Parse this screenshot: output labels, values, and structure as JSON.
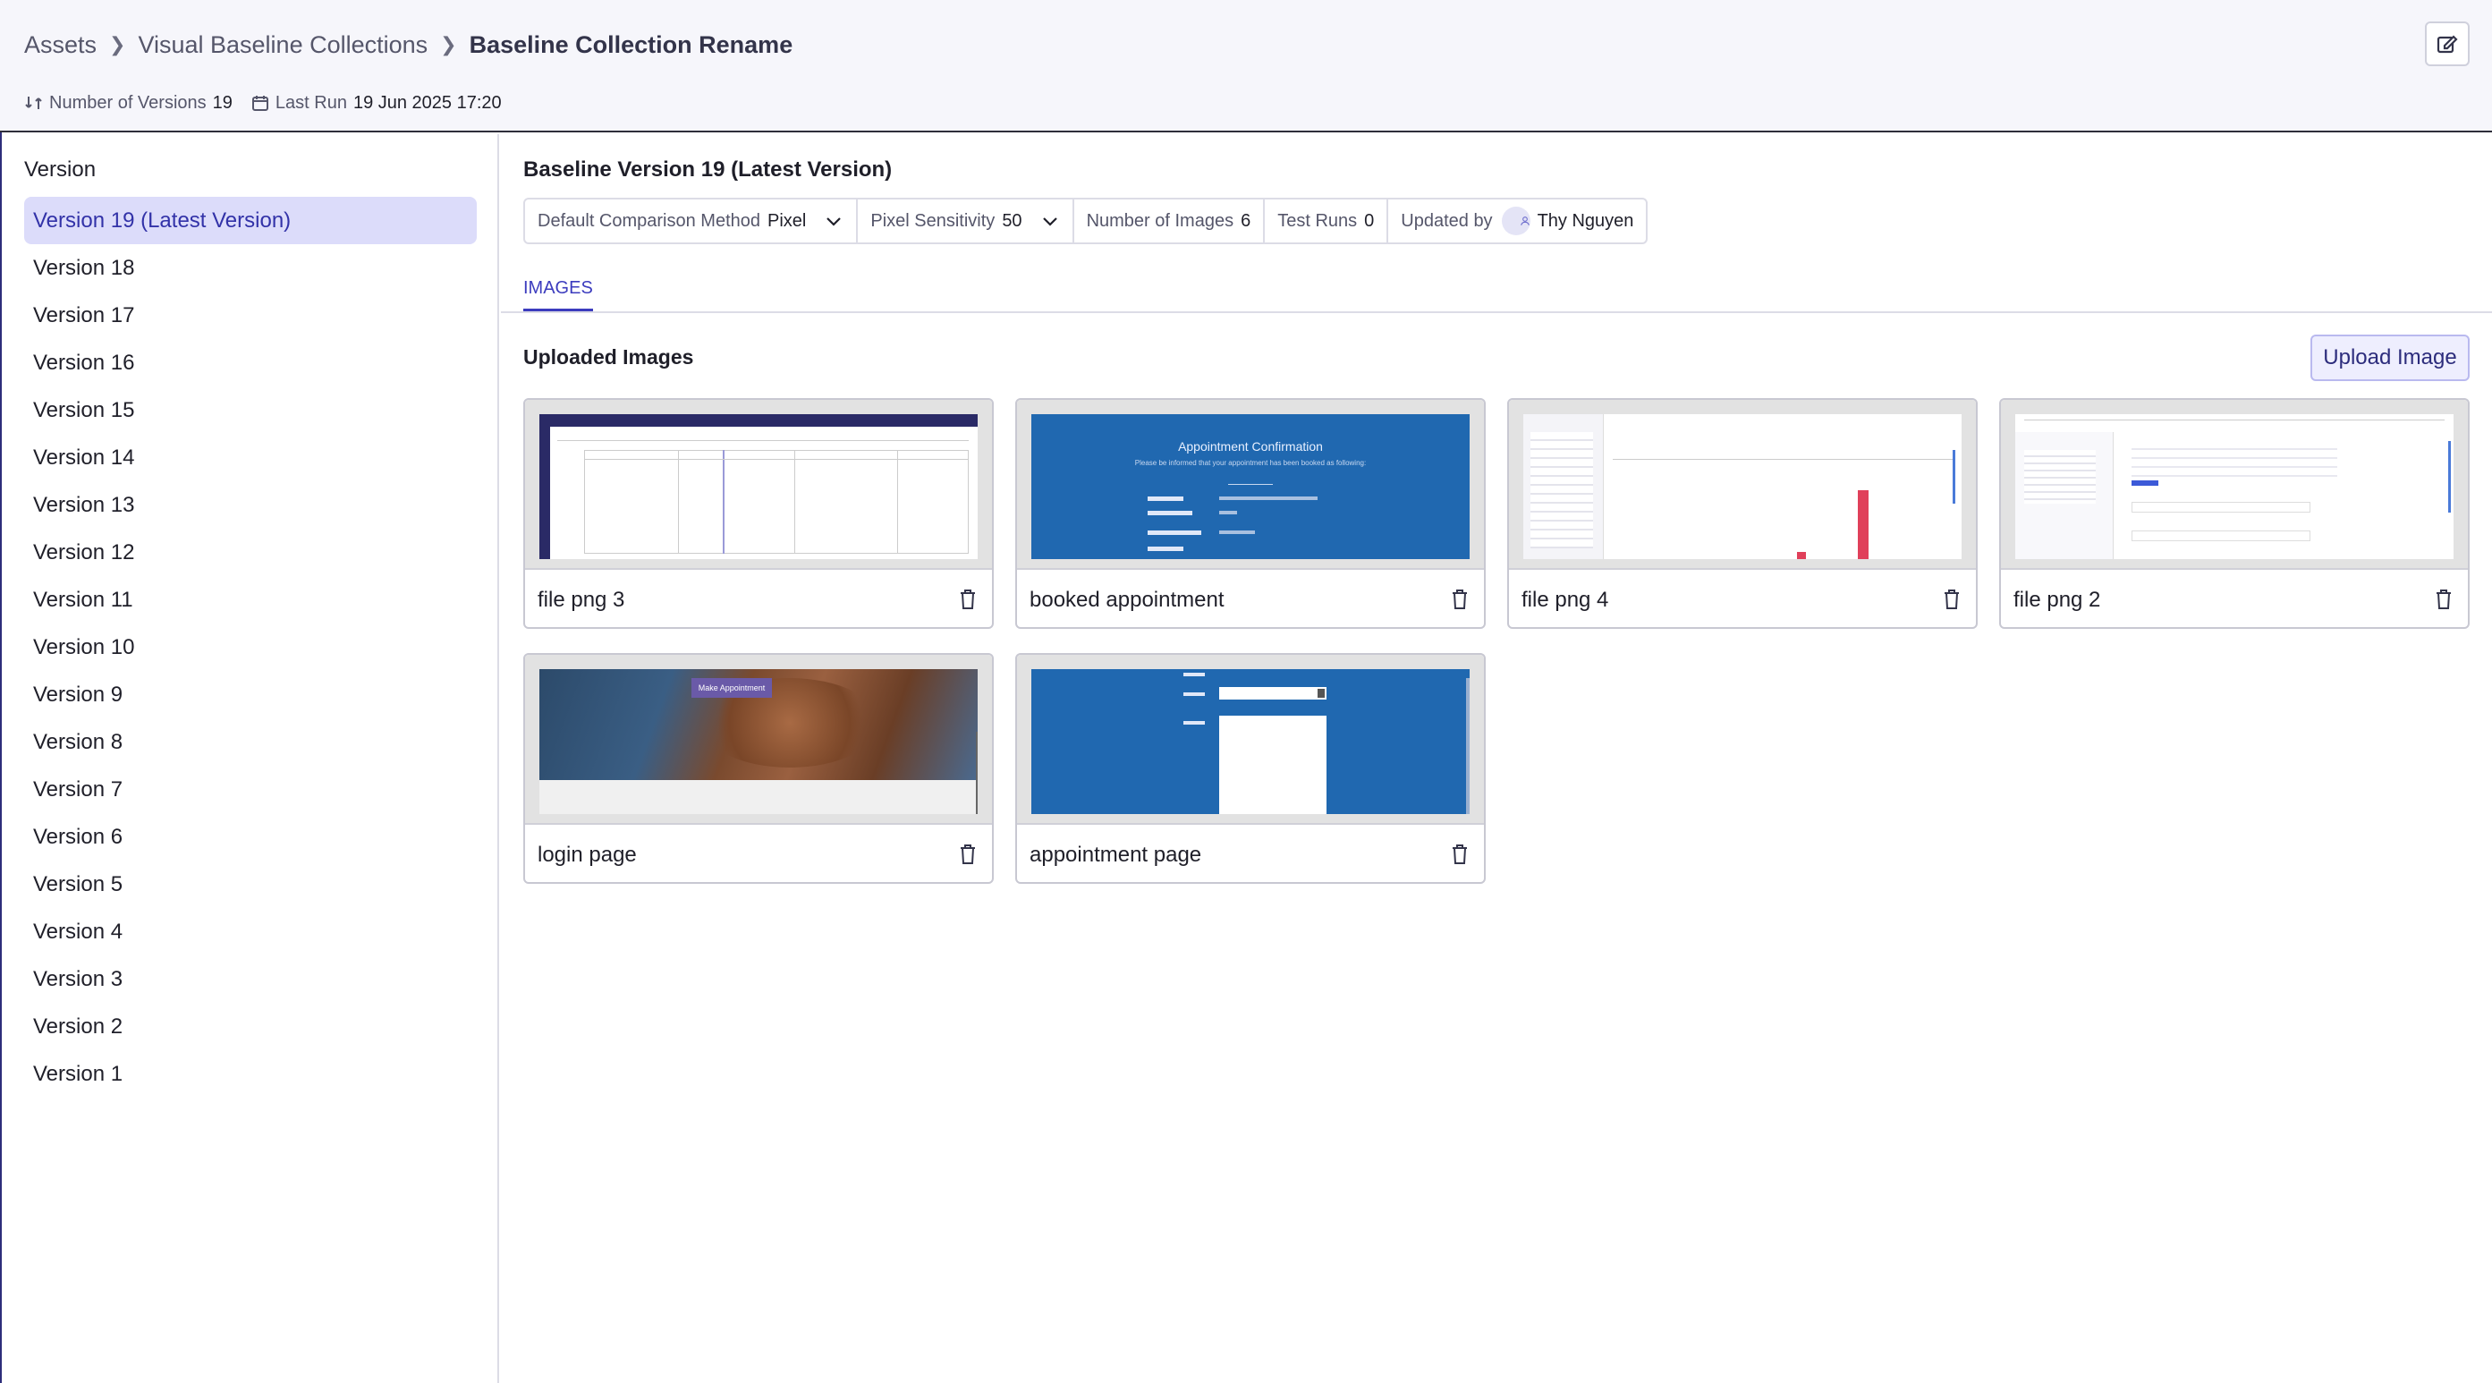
{
  "header": {
    "breadcrumb": [
      "Assets",
      "Visual Baseline Collections",
      "Baseline Collection Rename"
    ],
    "versions_label": "Number of Versions",
    "versions_value": "19",
    "last_run_label": "Last Run",
    "last_run_value": "19 Jun 2025 17:20"
  },
  "sidebar": {
    "title": "Version",
    "items": [
      {
        "label": "Version 19 (Latest Version)",
        "active": true
      },
      {
        "label": "Version 18"
      },
      {
        "label": "Version 17"
      },
      {
        "label": "Version 16"
      },
      {
        "label": "Version 15"
      },
      {
        "label": "Version 14"
      },
      {
        "label": "Version 13"
      },
      {
        "label": "Version 12"
      },
      {
        "label": "Version 11"
      },
      {
        "label": "Version 10"
      },
      {
        "label": "Version 9"
      },
      {
        "label": "Version 8"
      },
      {
        "label": "Version 7"
      },
      {
        "label": "Version 6"
      },
      {
        "label": "Version 5"
      },
      {
        "label": "Version 4"
      },
      {
        "label": "Version 3"
      },
      {
        "label": "Version 2"
      },
      {
        "label": "Version 1"
      }
    ]
  },
  "main": {
    "title": "Baseline Version 19 (Latest Version)",
    "info": {
      "method_label": "Default Comparison Method",
      "method_value": "Pixel",
      "sensitivity_label": "Pixel Sensitivity",
      "sensitivity_value": "50",
      "images_label": "Number of Images",
      "images_value": "6",
      "runs_label": "Test Runs",
      "runs_value": "0",
      "updated_label": "Updated by",
      "updated_value": "Thy Nguyen"
    },
    "tab": "IMAGES",
    "section_title": "Uploaded Images",
    "upload_label": "Upload Image",
    "images": [
      {
        "name": "file png 3"
      },
      {
        "name": "booked appointment",
        "thumb_title": "Appointment Confirmation",
        "thumb_sub": "Please be informed that your appointment has been booked as following:"
      },
      {
        "name": "file png 4"
      },
      {
        "name": "file png 2"
      },
      {
        "name": "login page",
        "thumb_button": "Make Appointment"
      },
      {
        "name": "appointment page"
      }
    ]
  },
  "colors": {
    "accent": "#3c3cbe",
    "active_bg": "#dcdcfa",
    "thumb_blue": "#2068b0"
  }
}
